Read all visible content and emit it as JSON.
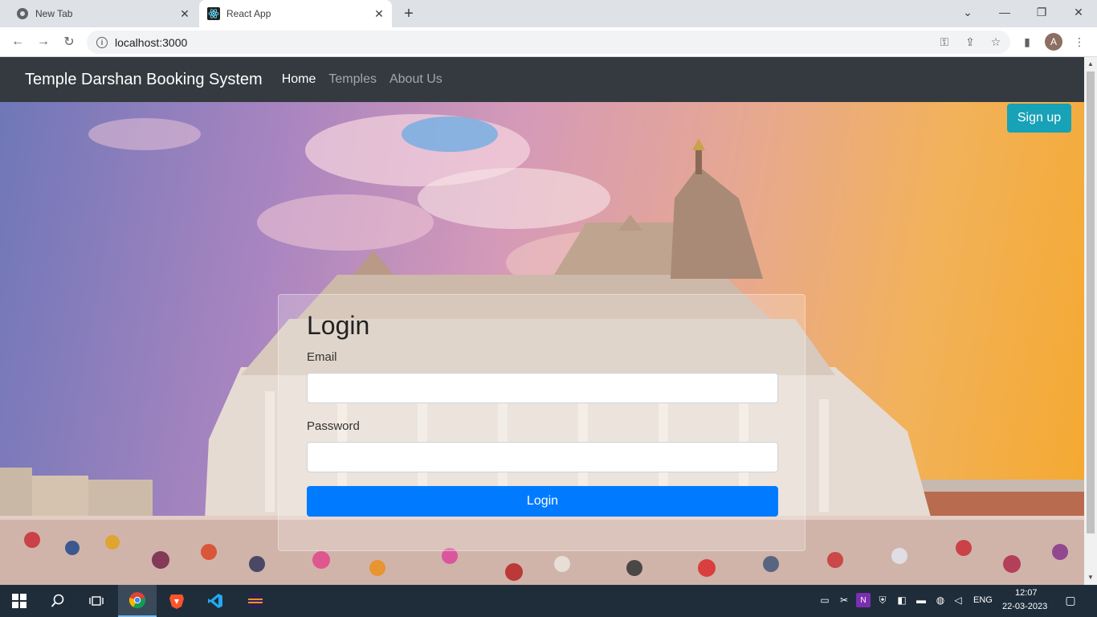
{
  "browser": {
    "tabs": [
      {
        "title": "New Tab",
        "active": false
      },
      {
        "title": "React App",
        "active": true
      }
    ],
    "url": "localhost:3000",
    "profile_initial": "A"
  },
  "navbar": {
    "brand": "Temple Darshan Booking System",
    "links": [
      {
        "label": "Home",
        "active": true
      },
      {
        "label": "Temples",
        "active": false
      },
      {
        "label": "About Us",
        "active": false
      }
    ]
  },
  "signup": {
    "label": "Sign up"
  },
  "login": {
    "title": "Login",
    "email_label": "Email",
    "email_value": "",
    "password_label": "Password",
    "password_value": "",
    "button_label": "Login"
  },
  "taskbar": {
    "language": "ENG",
    "time": "12:07",
    "date": "22-03-2023"
  },
  "colors": {
    "navbar_bg": "#343a40",
    "signup_bg": "#17a2b8",
    "login_btn_bg": "#007bff"
  }
}
